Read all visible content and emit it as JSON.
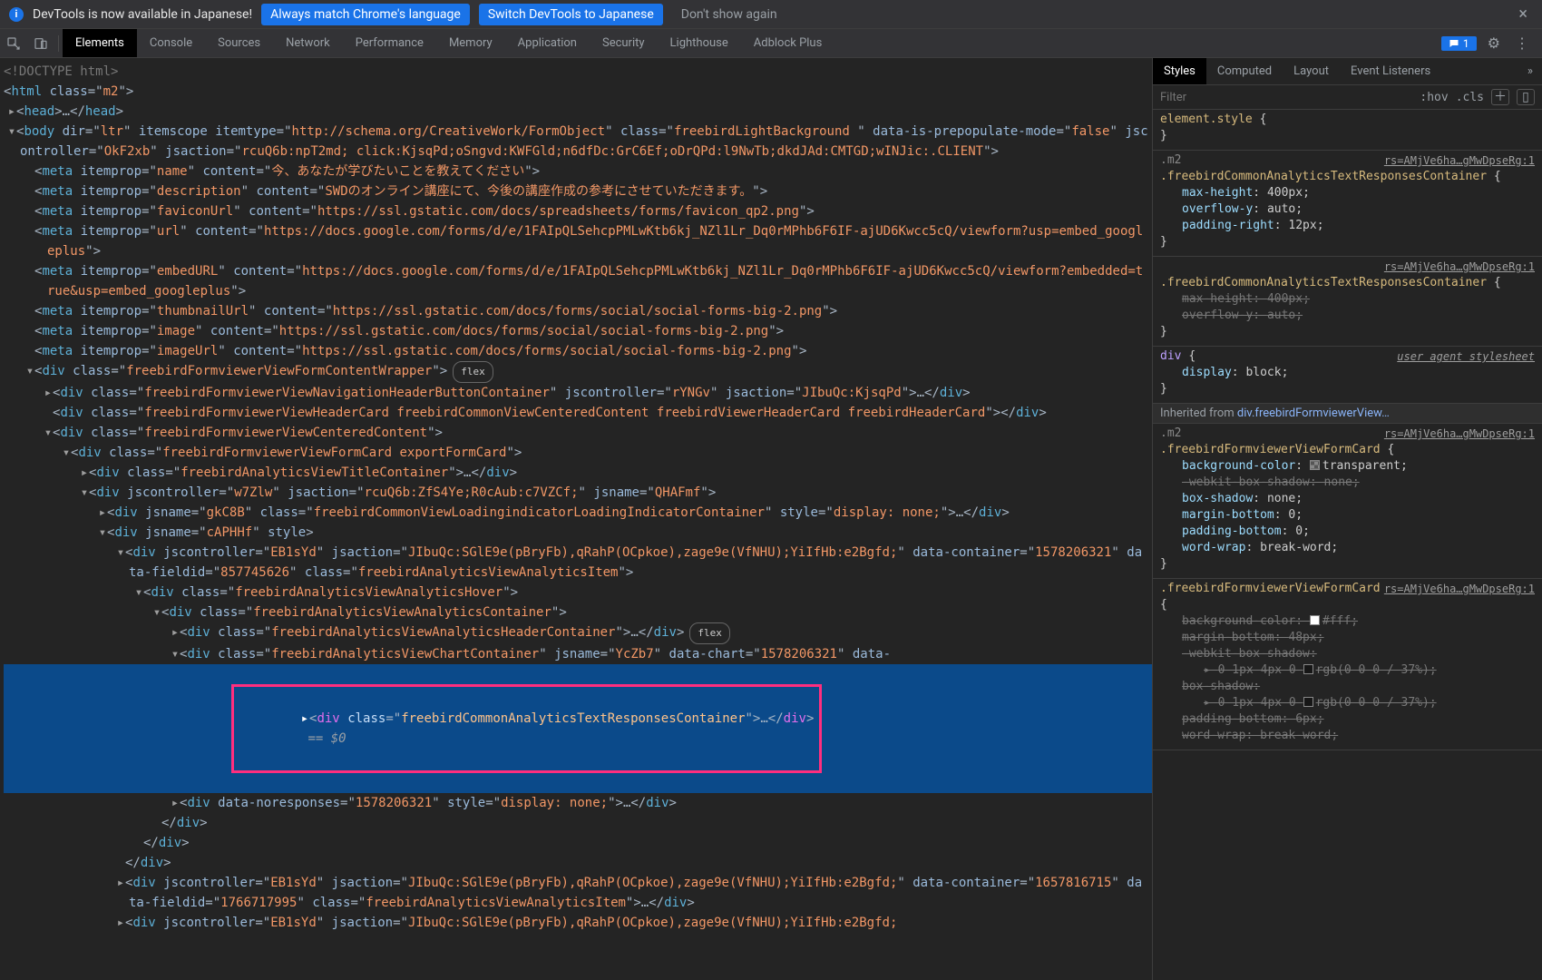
{
  "infobar": {
    "message": "DevTools is now available in Japanese!",
    "btn_match": "Always match Chrome's language",
    "btn_switch": "Switch DevTools to Japanese",
    "btn_never": "Don't show again"
  },
  "tabs": {
    "elements": "Elements",
    "console": "Console",
    "sources": "Sources",
    "network": "Network",
    "performance": "Performance",
    "memory": "Memory",
    "application": "Application",
    "security": "Security",
    "lighthouse": "Lighthouse",
    "adblock": "Adblock Plus"
  },
  "msgcount": "1",
  "dom": {
    "doctype": "<!DOCTYPE html>",
    "html_open": "<html class=\"m2\">",
    "head": "▸<head>…</head>",
    "body_open": "▾<body dir=\"ltr\" itemscope itemtype=\"http://schema.org/CreativeWork/FormObject\" class=\"freebirdLightBackground \" data-is-prepopulate-mode=\"false\" jscontroller=\"OkF2xb\" jsaction=\"rcuQ6b:npT2md; click:KjsqPd;oSngvd:KWFGld;n6dfDc:GrC6Ef;oDrQPd:l9NwTb;dkdJAd:CMTGD;wINJic:.CLIENT\">",
    "meta_name": "<meta itemprop=\"name\" content=\"今、あなたが学びたいことを教えてください\">",
    "meta_desc": "<meta itemprop=\"description\" content=\"SWDのオンライン講座にて、今後の講座作成の参考にさせていただきます。\">",
    "meta_favicon": "<meta itemprop=\"faviconUrl\" content=\"https://ssl.gstatic.com/docs/spreadsheets/forms/favicon_qp2.png\">",
    "meta_url": "<meta itemprop=\"url\" content=\"https://docs.google.com/forms/d/e/1FAIpQLSehcpPMLwKtb6kj_NZl1Lr_Dq0rMPhb6F6IF-ajUD6Kwcc5cQ/viewform?usp=embed_googleplus\">",
    "meta_embed": "<meta itemprop=\"embedURL\" content=\"https://docs.google.com/forms/d/e/1FAIpQLSehcpPMLwKtb6kj_NZl1Lr_Dq0rMPhb6F6IF-ajUD6Kwcc5cQ/viewform?embedded=true&usp=embed_googleplus\">",
    "meta_thumb": "<meta itemprop=\"thumbnailUrl\" content=\"https://ssl.gstatic.com/docs/forms/social/social-forms-big-2.png\">",
    "meta_image": "<meta itemprop=\"image\" content=\"https://ssl.gstatic.com/docs/forms/social/social-forms-big-2.png\">",
    "meta_imageurl": "<meta itemprop=\"imageUrl\" content=\"https://ssl.gstatic.com/docs/forms/social/social-forms-big-2.png\">",
    "wrapper": "▾<div class=\"freebirdFormviewerViewFormContentWrapper\">",
    "wrapper_pill": "flex",
    "navbtn": "▸<div class=\"freebirdFormviewerViewNavigationHeaderButtonContainer\" jscontroller=\"rYNGv\" jsaction=\"JIbuQc:KjsqPd\">…</div>",
    "headercard": "<div class=\"freebirdFormviewerViewHeaderCard freebirdCommonViewCenteredContent freebirdViewerHeaderCard freebirdHeaderCard\"></div>",
    "centered": "▾<div class=\"freebirdFormviewerViewCenteredContent\">",
    "formcard": "▾<div class=\"freebirdFormviewerViewFormCard exportFormCard\">",
    "titlecont": "▸<div class=\"freebirdAnalyticsViewTitleContainer\">…</div>",
    "w7zlw": "▾<div jscontroller=\"w7Zlw\" jsaction=\"rcuQ6b:ZfS4Ye;R0cAub:c7VZCf;\" jsname=\"QHAFmf\">",
    "loading": "▸<div jsname=\"gkC8B\" class=\"freebirdCommonViewLoadingindicatorLoadingIndicatorContainer\" style=\"display: none;\">…</div>",
    "caphhf": "▾<div jsname=\"cAPHHf\" style>",
    "item1": "▾<div jscontroller=\"EB1sYd\" jsaction=\"JIbuQc:SGlE9e(pBryFb),qRahP(OCpkoe),zage9e(VfNHU);YiIfHb:e2Bgfd;\" data-container=\"1578206321\" data-fieldid=\"857745626\" class=\"freebirdAnalyticsViewAnalyticsItem\">",
    "hover": "▾<div class=\"freebirdAnalyticsViewAnalyticsHover\">",
    "acont": "▾<div class=\"freebirdAnalyticsViewAnalyticsContainer\">",
    "headercont": "▸<div class=\"freebirdAnalyticsViewAnalyticsHeaderContainer\">…</div>",
    "headercont_pill": "flex",
    "chart": "▾<div class=\"freebirdAnalyticsViewChartContainer\" jsname=\"YcZb7\" data-chart=\"1578206321\" data-…",
    "picked": "▸<div class=\"freebirdCommonAnalyticsTextResponsesContainer\">…</div>",
    "picked_suffix": " == $0",
    "noresp": "▸<div data-noresponses=\"1578206321\" style=\"display: none;\">…</div>",
    "close_div": "</div>",
    "item2": "▸<div jscontroller=\"EB1sYd\" jsaction=\"JIbuQc:SGlE9e(pBryFb),qRahP(OCpkoe),zage9e(VfNHU);YiIfHb:e2Bgfd;\" data-container=\"1657816715\" data-fieldid=\"1766717995\" class=\"freebirdAnalyticsViewAnalyticsItem\">…</div>",
    "item3": "▸<div jscontroller=\"EB1sYd\" jsaction=\"JIbuQc:SGlE9e(pBryFb),qRahP(OCpkoe),zage9e(VfNHU);YiIfHb:e2Bgfd;"
  },
  "styles": {
    "tabs": {
      "styles": "Styles",
      "computed": "Computed",
      "layout": "Layout",
      "events": "Event Listeners"
    },
    "filter_placeholder": "Filter",
    "hov": ":hov",
    "cls": ".cls",
    "element_style": "element.style",
    "srclink": "rs=AMjVe6ha…gMwDpseRg:1",
    "rule1_sel": ".m2 .freebirdCommonAnalyticsTextResponsesContainer",
    "rule1_p1": "max-height",
    "rule1_v1": "400px",
    "rule1_p2": "overflow-y",
    "rule1_v2": "auto",
    "rule1_p3": "padding-right",
    "rule1_v3": "12px",
    "rule2_sel": ".freebirdCommonAnalyticsTextResponsesContainer",
    "rule2_p1": "max-height",
    "rule2_v1": "400px",
    "rule2_p2": "overflow-y",
    "rule2_v2": "auto",
    "ua_sel": "div",
    "ua_label": "user agent stylesheet",
    "ua_p1": "display",
    "ua_v1": "block",
    "inherited_label": "Inherited from",
    "inherited_from": "div.freebirdFormviewerView…",
    "rule3_sel": ".m2 .freebirdFormviewerViewFormCard",
    "rule3_p1": "background-color",
    "rule3_v1": "transparent",
    "rule3_p2": "-webkit-box-shadow",
    "rule3_v2": "none",
    "rule3_p3": "box-shadow",
    "rule3_v3": "none",
    "rule3_p4": "margin-bottom",
    "rule3_v4": "0",
    "rule3_p5": "padding-bottom",
    "rule3_v5": "0",
    "rule3_p6": "word-wrap",
    "rule3_v6": "break-word",
    "rule4_sel": ".freebirdFormviewerViewFormCard",
    "rule4_p1": "background-color",
    "rule4_v1": "#fff",
    "rule4_p2": "margin-bottom",
    "rule4_v2": "48px",
    "rule4_p3": "-webkit-box-shadow",
    "rule4_p3v": "0 1px 4px 0 ",
    "rule4_p3c": "rgb(0 0 0 / 37%)",
    "rule4_p4": "box-shadow",
    "rule4_p5": "padding-bottom",
    "rule4_v5": "6px",
    "rule4_p6": "word-wrap",
    "rule4_v6": "break-word"
  }
}
